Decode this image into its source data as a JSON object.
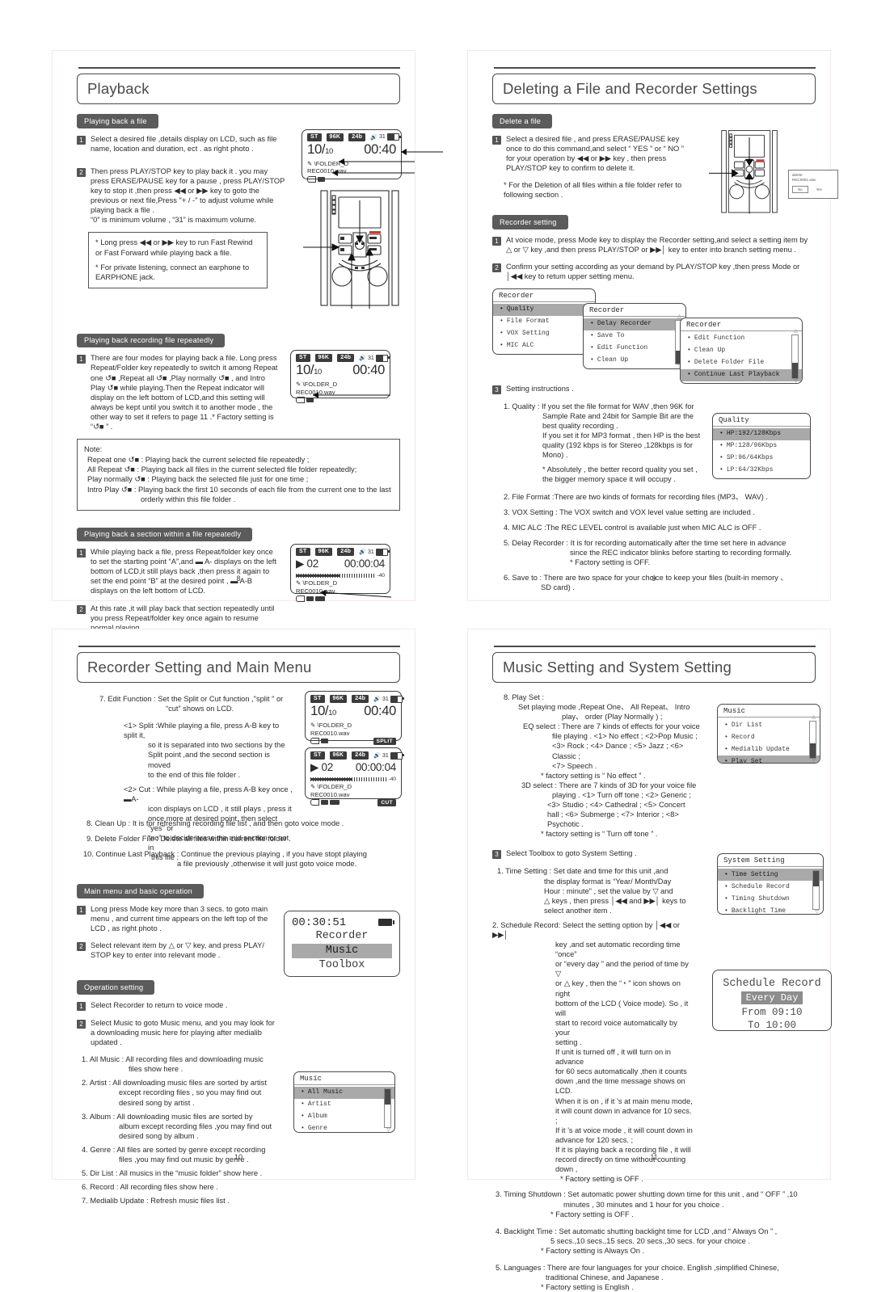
{
  "pages": [
    {
      "id": "page-8",
      "number": "8",
      "title": "Playback",
      "sections": {
        "s1": "Playing back a file",
        "s2": "Playing back recording file repeatedly",
        "s3": "Playing back a section within a file repeatedly"
      },
      "step1": "Select a desired file ,details display on LCD, such as file name, location and duration, ect . as right photo .",
      "step2": "Then press PLAY/STOP key to play back it . you may press ERASE/PAUSE key for a pause , press PLAY/STOP key to stop it ,then press ◀◀ or ▶▶ key to goto the previous or next file,Press \"+ / -\" to adjust volume while playing back a file .",
      "step2b": "“0” is minimum volume , “31” is maximum volume.",
      "tipbox1": "* Long press ◀◀ or ▶▶ key to run Fast Rewind or Fast Forward while playing back a file.",
      "tipbox2": "* For private listening, connect an earphone to EARPHONE jack.",
      "rep_step1": "There are four modes for playing back a file. Long press Repeat/Folder key repeatedly to switch it among Repeat one ↺■ ,Repeat all ↺■ ,Play normally ↺■ , and Intro Play ↺■ while playing.Then the Repeat indicator will display on the left bottom of LCD,and this setting will always be kept until you switch it to another mode , the other way to set it refers to page 11 .* Factory setting is “↺■ ” .",
      "note_title": "Note:",
      "note_lines": [
        "Repeat one ↺■ : Playing back the current selected file repeatedly ;",
        "All Repeat ↺■ : Playing back all files in the current selected file folder repeatedly;",
        "Play normally ↺■ : Playing back the selected file just for one time ;",
        "Intro Play ↺■ : Playing back the first 10 seconds of each file from the current one to the last",
        "orderly within this file folder ."
      ],
      "sec_step1": "While playing back a file, press Repeat/folder key once to set the starting point “A”,and ▬ A- displays on the left bottom of LCD,it still plays back ,then press it again to set the end point “B” at the desired point , ▬ A-B displays on the left bottom of LCD.",
      "sec_step2": "At this rate ,it will play back that section repeatedly until you press Repeat/folder key once again to resume normal playing ."
    },
    {
      "id": "page-9",
      "number": "9",
      "title": "Deleting a File and Recorder Settings",
      "sections": {
        "s1": "Delete a file",
        "s2": "Recorder setting"
      },
      "del_step1": "Select a desired file , and press ERASE/PAUSE key once to do this command,and select “ YES ” or “ NO ” for your operation by ◀◀ or ▶▶ key , then press PLAY/STOP key to confirm to delete it.",
      "del_note": "* For the Deletion of all files within a file folder  refer to following section .",
      "rec_step1": "At voice mode, press Mode key  to display the Recorder setting,and select a setting item by △ or ▽ key ,and then press PLAY/STOP or ▶▶│ key to enter into branch setting menu .",
      "rec_step2": "Confirm your setting according as your demand by PLAY/STOP key ,then press Mode or │◀◀ key to retum upper setting menu.",
      "step3_label": "Setting instructions .",
      "instructions": [
        "1. Quality : If you set the file format for WAV ,then 96K for",
        "Sample Rate and 24bit for Sample Bit are the",
        "best quality recording .",
        "If you set  it for MP3 format , then HP is the best",
        "quality (192 kbps is for Stereo ,128kbps   is for",
        "Mono) .",
        "* Absolutely , the better record quality you set ,",
        "the bigger memory space it will occupy .",
        "2. File Format :There are two kinds of formats for recording files (MP3、 WAV) .",
        "3. VOX Setting : The VOX switch and VOX level value setting are included .",
        "4. MIC ALC :The REC LEVEL control is available just when MIC ALC is OFF .",
        "5. Delay Recorder : It is for recording automatically after the time set here in advance",
        "since the REC indicator blinks before starting to recording formally.",
        "* Factory setting is OFF.",
        "6. Save to : There are two space for your choice to keep your files (built-in memory 、",
        "SD card) ."
      ],
      "dialog": {
        "line1": "delete",
        "line2": "REC0001.wav",
        "no": "No",
        "yes": "Yes"
      }
    },
    {
      "id": "page-10",
      "number": "10",
      "title": "Recorder Setting and Main Menu",
      "sections": {
        "s1": "Main menu and basic operation",
        "s2": "Operation setting"
      },
      "lines_top": [
        "7. Edit Function : Set the Split or Cut function ,\"split \" or",
        "“cut” shows on LCD.",
        "<1> Split :While playing a file, press A-B key to split it,",
        "so it is separated into two sections by the",
        "Split point ,and the second section is moved",
        "to the end of this file folder .",
        "<2> Cut : While playing a file, press A-B key once , ▬A-",
        "icon displays on LCD , it still plays , press it",
        "once more at desired point, then select “yes” or",
        "“no” to decide erase the mid section or not in",
        "this file .",
        "8. Clean Up : It is for refreshing recording file list , and then goto voice mode .",
        "9. Delete Folder  File : Delete all files within current file folder .",
        "10. Continue Last Playback : Continue the previous playing , if you have stopt playing",
        "a file previously ,otherwise it will just goto voice mode."
      ],
      "main_step1": "Long press Mode key more than 3 secs. to goto main menu , and current time appears on the left top of the LCD , as right photo .",
      "main_step2": "Select relevant item by △ or ▽ key, and press PLAY/ STOP key to enter into relevant mode .",
      "op_step1": "Select Recorder to return to voice mode .",
      "op_step2": "Select Music to goto Music menu, and you may look for a downloading music here for playing after medialib updated .",
      "op_lines": [
        "1. All Music : All recording files and downloading music",
        "files show here .",
        "2. Artist : All downloading music files are sorted by artist",
        "except recording files , so you may find out",
        "desired song by artist .",
        "3. Album : All downloading music files are sorted by",
        "album except recording files ,you may find out",
        "desired song by album .",
        "4. Genre : All files are sorted by genre except recording",
        "files ,you may find out music by genre .",
        "5. Dir List : All musics in the “music folder” show here .",
        "6. Record : All recording files show here .",
        "7. Medialib Update : Refresh music files list ."
      ],
      "mainmenu_lcd": {
        "time": "00:30:51",
        "items": [
          "Recorder",
          "Music",
          "Toolbox"
        ],
        "selected": 1
      },
      "music_menu": {
        "header": "Music",
        "items": [
          "All Music",
          "Artist",
          "Album",
          "Genre"
        ],
        "selected": 0
      }
    },
    {
      "id": "page-11",
      "number": "11",
      "title": "Music Setting and System Setting",
      "playset_lines": [
        "8. Play Set :",
        "Set playing mode ,Repeat One、 All Repeat、 Intro",
        "play、 order (Play Normally ) ;",
        "EQ select : There are 7 kinds of effects for your voice",
        "file playing . <1> No effect ; <2>Pop Music ;",
        "<3> Rock ; <4> Dance ; <5> Jazz ; <6> Classic ;",
        "<7> Speech .",
        "* factory setting is “ No effect ” .",
        "3D select : There are 7 kinds of  3D for your voice file",
        "playing . <1> Turn off tone ; <2> Generic ;",
        "<3> Studio ; <4> Cathedral ; <5> Concert",
        "hall ; <6> Submerge ; <7> Interior ; <8>",
        "Psychotic .",
        "* factory setting is “ Turn off tone ” ."
      ],
      "toolbox_step": "Select Toolbox to goto System Setting .",
      "sys_lines": [
        "1. Time Setting : Set date and time for this unit ,and",
        "the display format is “Year/ Month/Day",
        "Hour : minute” , set the value by ▽ and",
        "△ keys , then press │◀◀ and ▶▶│ keys to",
        "select another item .",
        "2. Schedule Record: Select the setting option by │◀◀ or ▶▶│",
        "key ,and set automatic recording time “once”",
        "or “every day ”  and the period of time by  ▽",
        "or △ key , then the “◔ ” icon shows on right",
        "bottom of the LCD ( Voice mode). So , it will",
        "start to record voice automatically by your",
        "setting .",
        "If unit is turned off , it will turn on in advance",
        "for 60 secs automatically ,then it counts",
        "down ,and the time message shows on LCD.",
        "When it is on , if it ’s at main menu mode,",
        "it will count down in advance for 10 secs. ;",
        "If it ’s at voice mode , it will count down in",
        "advance for 120 secs. ;",
        "If it is playing back a recording file , it will",
        "record directly on time without  counting down ,",
        "* Factory setting is OFF .",
        "3. Timing Shutdown : Set automatic power shutting down time for this unit , and “ OFF ” ,10",
        "minutes , 30 minutes and 1 hour for you choice .",
        "* Factory setting is OFF .",
        "4. Backlight Time : Set automatic shutting backlight time for LCD ,and “ Always On ” ,",
        "5 secs.,10 secs.,15 secs. 20 secs.,30 secs. for your choice .",
        "* Factory setting is Always On .",
        "5. Languages : There are four languages for your choice. English ,simplified Chinese,",
        "traditional Chinese, and Japanese .",
        "* Factory setting is English ."
      ],
      "music_menu2": {
        "header": "Music",
        "items": [
          "Dir List",
          "Record",
          "Medialib Update",
          "Play Set"
        ],
        "selected": 3
      },
      "system_menu": {
        "header": "System Setting",
        "items": [
          "Time Setting",
          "Schedule Record",
          "Timing Shutdown",
          "Backlight Time"
        ],
        "selected": 0
      },
      "schedule_lcd": {
        "title": "Schedule Record",
        "mode": "Every Day",
        "from": "From 09:10",
        "to": "To 10:00"
      }
    }
  ],
  "lcds": {
    "play": {
      "st": "ST",
      "rate": "96K",
      "bit": "24b",
      "vol": "31",
      "file_index": "10",
      "file_total": "10",
      "time": "00:40",
      "path": "\\FOLDER_D",
      "filename": "REC0010.wav"
    },
    "repeat": {
      "st": "ST",
      "rate": "96K",
      "bit": "24b",
      "vol": "31",
      "file_index": "10",
      "file_total": "10",
      "time": "00:40",
      "path": "\\FOLDER_D",
      "filename": "REC0010.wav"
    },
    "ab": {
      "st": "ST",
      "rate": "96K",
      "bit": "24b",
      "vol": "31",
      "track": "▶ 02",
      "time": "00:00:04",
      "level": "-40",
      "path": "\\FOLDER_D",
      "filename": "REC0010.wav"
    },
    "split": {
      "st": "ST",
      "rate": "96K",
      "bit": "24b",
      "vol": "31",
      "file_index": "10",
      "file_total": "10",
      "time": "00:40",
      "path": "\\FOLDER_D",
      "filename": "REC0010.wav",
      "badge": "SPLIT"
    },
    "cut": {
      "st": "ST",
      "rate": "96K",
      "bit": "24b",
      "vol": "31",
      "track": "▶ 02",
      "time": "00:00:04",
      "level": "-40",
      "path": "\\FOLDER_D",
      "filename": "REC0010.wav",
      "badge": "CUT"
    }
  },
  "recorder_menus": [
    {
      "header": "Recorder",
      "items": [
        "Quality",
        "File Format",
        "VOX Setting",
        "MIC ALC"
      ],
      "selected": 0
    },
    {
      "header": "Recorder",
      "items": [
        "Delay Recorder",
        "Save To",
        "Edit Function",
        "Clean Up"
      ],
      "selected": 0
    },
    {
      "header": "Recorder",
      "items": [
        "Edit Function",
        "Clean Up",
        "Delete Folder File",
        "Continue Last Playback"
      ],
      "selected": 3
    },
    {
      "header": "Quality",
      "items": [
        "HP:192/128Kbps",
        "MP:128/96Kbps",
        "SP:96/64Kbps",
        "LP:64/32Kbps"
      ],
      "selected": 0
    }
  ]
}
